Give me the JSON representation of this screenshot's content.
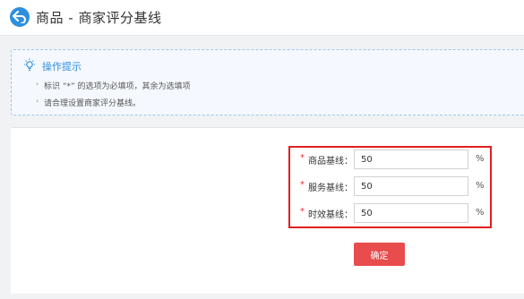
{
  "header": {
    "title": "商品 - 商家评分基线"
  },
  "tips": {
    "title": "操作提示",
    "items": [
      "标识 “*” 的选项为必填项，其余为选填项",
      "请合理设置商家评分基线。"
    ]
  },
  "form": {
    "required_mark": "*",
    "fields": [
      {
        "label": "商品基线：",
        "value": "50",
        "unit": "%"
      },
      {
        "label": "服务基线：",
        "value": "50",
        "unit": "%"
      },
      {
        "label": "时效基线：",
        "value": "50",
        "unit": "%"
      }
    ],
    "submit_label": "确定"
  },
  "colors": {
    "accent": "#2f8fde",
    "required": "#e0322d",
    "submit": "#e84c4c",
    "highlight": "#e02020"
  },
  "icons": {
    "back": "back-arrow-icon",
    "tips": "lightbulb-icon"
  }
}
